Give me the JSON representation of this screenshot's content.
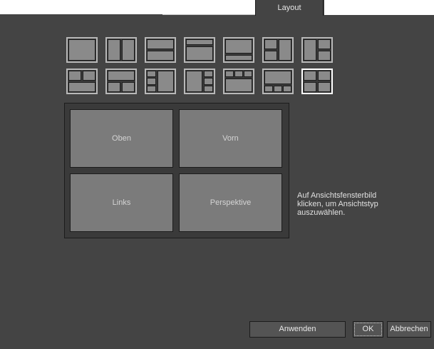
{
  "tabs": {
    "active_label": "Layout"
  },
  "layouts": {
    "row1": [
      "layout-1-single",
      "layout-2-vertical",
      "layout-2-horizontal",
      "layout-2-horizontal-top-small",
      "layout-2-horizontal-bottom-small",
      "layout-3-left-split",
      "layout-3-right-split"
    ],
    "row2": [
      "layout-3-top-split",
      "layout-3-bottom-split",
      "layout-4-left-column",
      "layout-4-right-column",
      "layout-4-top-row",
      "layout-4-bottom-row",
      "layout-4-grid"
    ],
    "selected": "layout-4-grid"
  },
  "viewports": {
    "top_left": "Oben",
    "top_right": "Vorn",
    "bottom_left": "Links",
    "bottom_right": "Perspektive"
  },
  "hint": "Auf Ansichtsfensterbild klicken, um Ansichtstyp auszuwählen.",
  "buttons": {
    "apply": "Anwenden",
    "ok": "OK",
    "cancel": "Abbrechen"
  }
}
